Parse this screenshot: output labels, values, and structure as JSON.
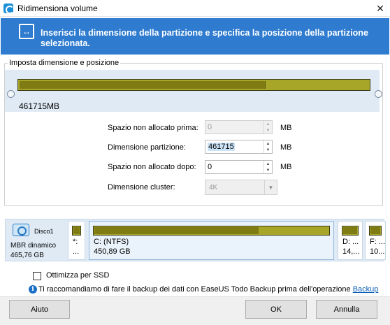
{
  "window": {
    "title": "Ridimensiona volume",
    "close_glyph": "✕"
  },
  "banner": {
    "icon": "resize-arrows-icon",
    "glyph": "↔",
    "text": "Inserisci la dimensione della partizione e specifica la posizione della partizione selezionata.",
    "background": "#2e7bcf"
  },
  "group": {
    "label": "Imposta dimensione e posizione"
  },
  "volume_bar": {
    "size_label": "461715MB",
    "used_fraction": 0.705,
    "used_color": "#7e7c12",
    "free_color": "#a8a628"
  },
  "fields": {
    "unalloc_before": {
      "label": "Spazio non allocato prima:",
      "value": "0",
      "unit": "MB",
      "disabled": true
    },
    "partition_size": {
      "label": "Dimensione partizione:",
      "value": "461715",
      "unit": "MB"
    },
    "unalloc_after": {
      "label": "Spazio non allocato dopo:",
      "value": "0",
      "unit": "MB"
    },
    "cluster_size": {
      "label": "Dimensione cluster:",
      "value": "4K",
      "disabled": true
    }
  },
  "disk": {
    "name": "Disco1",
    "type": "MBR dinamico",
    "size": "465,76 GB",
    "partitions": [
      {
        "label1": "*:",
        "label2": "...",
        "fill": 1.0
      },
      {
        "label1": "C: (NTFS)",
        "label2": "450,89 GB",
        "fill": 0.7,
        "selected": true
      },
      {
        "label1": "D: ...",
        "label2": "14,...",
        "fill": 1.0
      },
      {
        "label1": "F: ...",
        "label2": "10...",
        "fill": 1.0
      }
    ]
  },
  "ssd_option": {
    "label": "Ottimizza per SSD",
    "checked": false
  },
  "info": {
    "text": "Ti raccomandiamo di fare il backup dei dati con EaseUS Todo Backup prima dell'operazione",
    "link": "Backup"
  },
  "buttons": {
    "help": "Aiuto",
    "ok": "OK",
    "cancel": "Annulla"
  }
}
